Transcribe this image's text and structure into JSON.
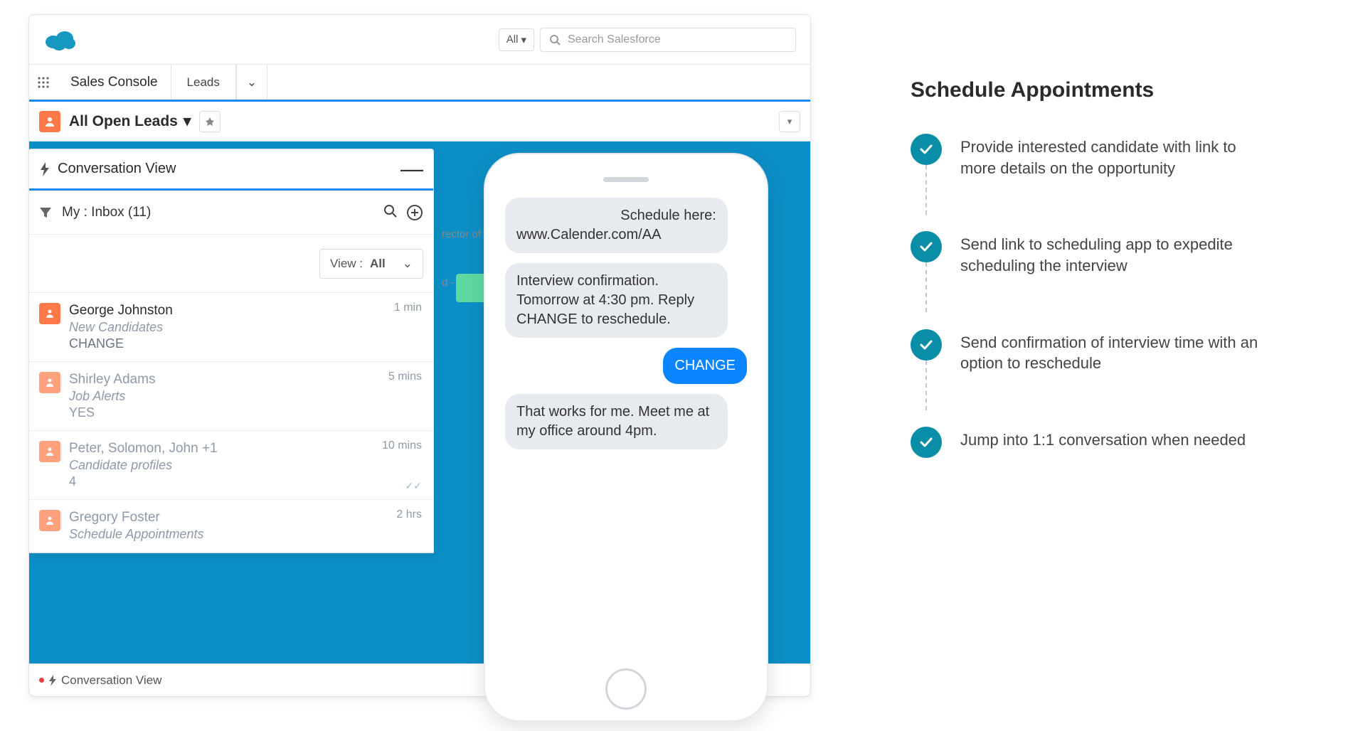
{
  "header": {
    "all_label": "All",
    "search_placeholder": "Search Salesforce"
  },
  "tabs": {
    "console_name": "Sales Console",
    "tab1": "Leads"
  },
  "subheader": {
    "title": "All Open Leads"
  },
  "panel": {
    "title": "Conversation View",
    "inbox_label": "My : Inbox (11)",
    "view_label": "View :",
    "view_value": "All"
  },
  "leads": [
    {
      "name": "George Johnston",
      "sub": "New Candidates",
      "msg": "CHANGE",
      "time": "1 min",
      "active": true
    },
    {
      "name": "Shirley Adams",
      "sub": "Job Alerts",
      "msg": "YES",
      "time": "5 mins",
      "active": false
    },
    {
      "name": "Peter, Solomon, John +1",
      "sub": "Candidate profiles",
      "msg": "4",
      "time": "10 mins",
      "active": false,
      "checks": true
    },
    {
      "name": "Gregory Foster",
      "sub": "Schedule Appointments",
      "msg": "",
      "time": "2 hrs",
      "active": false
    }
  ],
  "footer": {
    "label": "Conversation View"
  },
  "bg": {
    "director_text": "rector of V",
    "date_text": "d - No"
  },
  "phone": {
    "messages": [
      {
        "type": "grey",
        "align": "right-partial",
        "lines": [
          "Schedule here:",
          "www.Calender.com/AA"
        ]
      },
      {
        "type": "grey",
        "lines": [
          "Interview confirmation.",
          "Tomorrow at 4:30 pm. Reply CHANGE to reschedule."
        ]
      },
      {
        "type": "blue",
        "lines": [
          "CHANGE"
        ]
      },
      {
        "type": "grey",
        "lines": [
          "That works for me.",
          "Meet me at my office around 4pm."
        ]
      }
    ]
  },
  "right": {
    "title": "Schedule Appointments",
    "steps": [
      "Provide interested candidate with link to more details on the opportunity",
      "Send link to scheduling app to expedite scheduling  the interview",
      "Send confirmation of interview time with an option to reschedule",
      "Jump into 1:1 conversation when needed"
    ]
  }
}
